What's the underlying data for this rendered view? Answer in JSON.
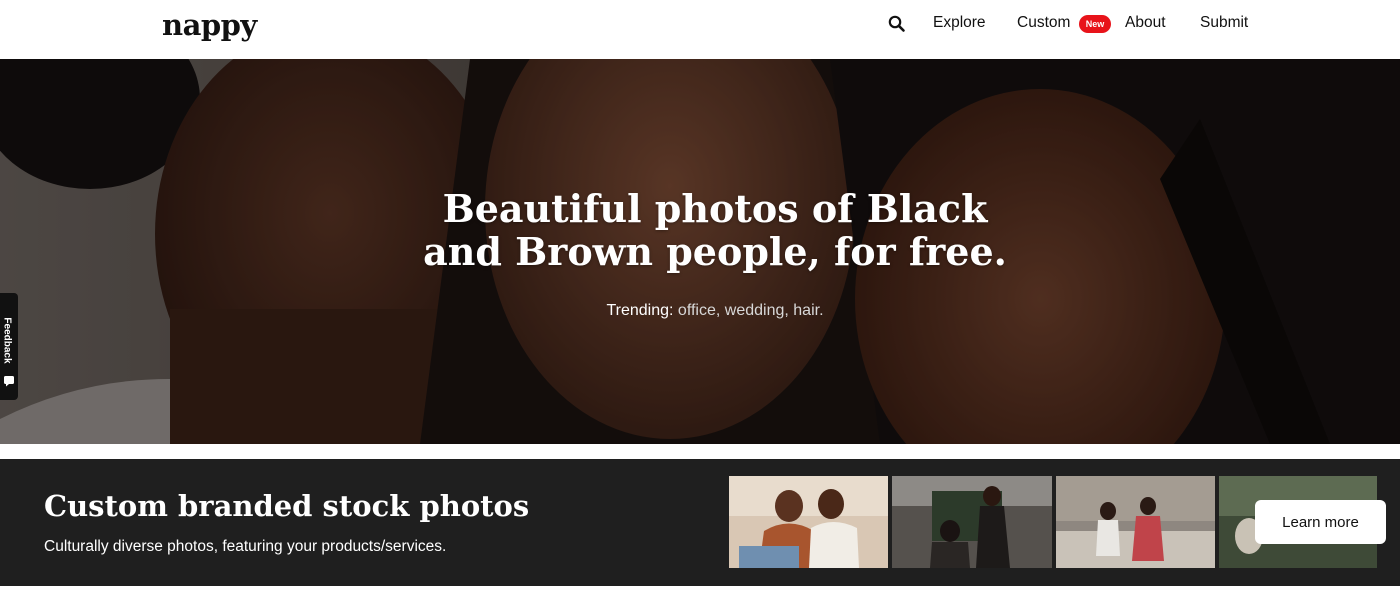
{
  "header": {
    "logo": "nappy",
    "nav": {
      "search_icon": "search-icon",
      "explore": "Explore",
      "custom": "Custom",
      "custom_badge": "New",
      "about": "About",
      "submit": "Submit"
    }
  },
  "hero": {
    "title_line1": "Beautiful photos of Black",
    "title_line2": "and Brown people, for free.",
    "trending_label": "Trending:",
    "trending_links": [
      "office,",
      "wedding,",
      "hair."
    ]
  },
  "feedback": {
    "label": "Feedback",
    "icon": "feedback-icon"
  },
  "promo": {
    "title": "Custom branded stock photos",
    "subtitle": "Culturally diverse photos, featuring your products/services.",
    "button": "Learn more"
  },
  "colors": {
    "badge_red": "#e8131a",
    "promo_bg": "#1f1f1f",
    "hero_bg": "#5b504b"
  }
}
